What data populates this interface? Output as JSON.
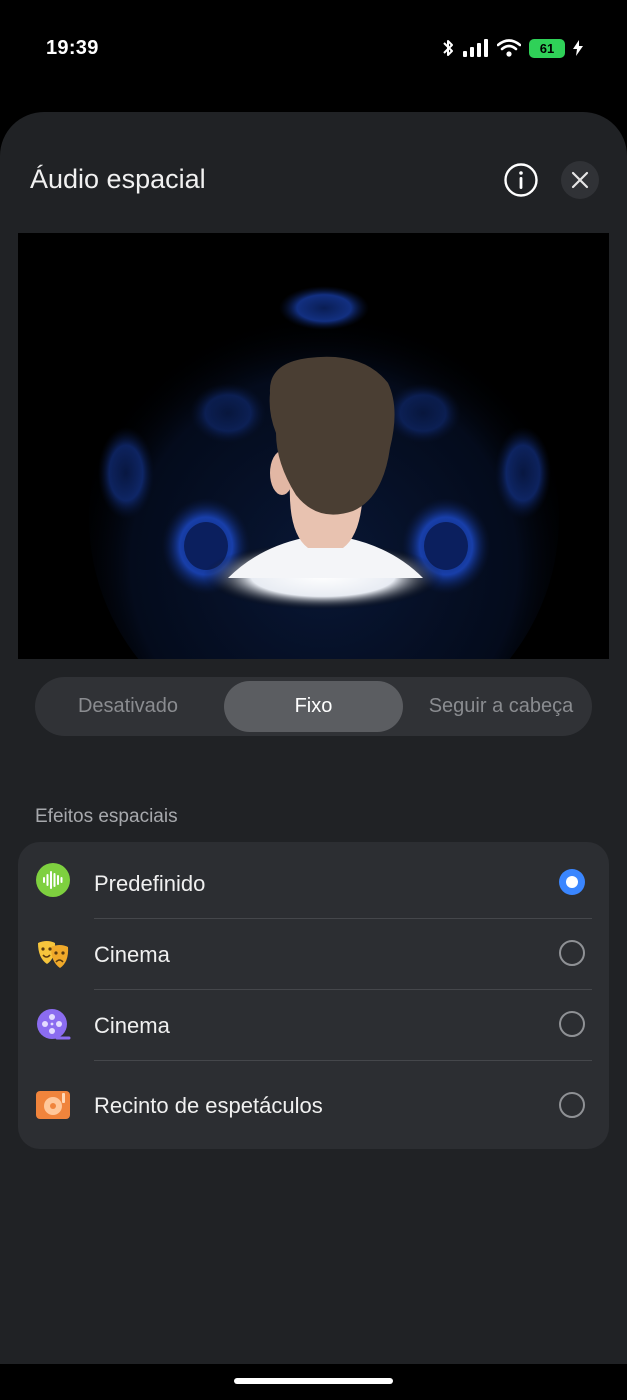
{
  "status_bar": {
    "time": "19:39",
    "battery": "61",
    "icons": [
      "bluetooth-icon",
      "signal-icon",
      "wifi-icon",
      "battery-icon",
      "charging-icon"
    ]
  },
  "sheet": {
    "title": "Áudio espacial",
    "info_icon": "info-icon",
    "close_icon": "close-icon"
  },
  "modes": {
    "items": [
      "Desativado",
      "Fixo",
      "Seguir a cabeça"
    ],
    "selected": "Fixo"
  },
  "effects": {
    "section_label": "Efeitos espaciais",
    "items": [
      {
        "label": "Predefinido",
        "icon": "soundwave-icon",
        "icon_color": "#7ed03f",
        "selected": true
      },
      {
        "label": "Cinema",
        "icon": "theater-masks-icon",
        "icon_color": "#f6c53c",
        "selected": false
      },
      {
        "label": "Cinema",
        "icon": "film-reel-icon",
        "icon_color": "#8b6cf0",
        "selected": false
      },
      {
        "label": "Recinto de espetáculos",
        "icon": "concert-hall-icon",
        "icon_color": "#f0843c",
        "selected": false
      }
    ]
  },
  "colors": {
    "accent": "#3a86ff",
    "sheet_bg": "#202225",
    "card_bg": "#2c2e32"
  }
}
